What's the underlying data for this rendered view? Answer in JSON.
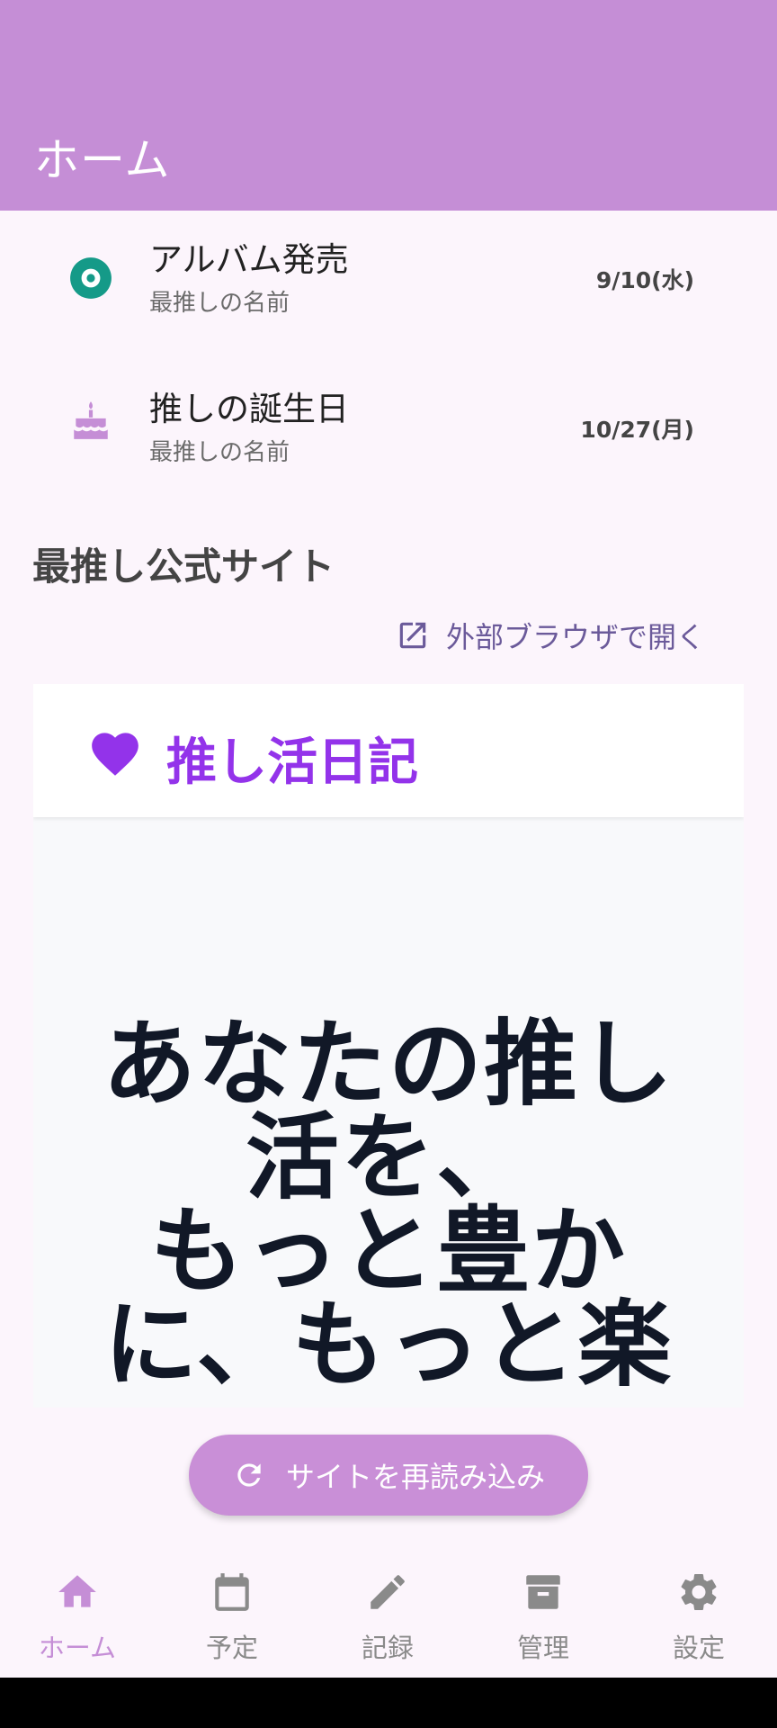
{
  "appbar": {
    "title": "ホーム"
  },
  "events": [
    {
      "icon": "disc-icon",
      "title": "アルバム発売",
      "subtitle": "最推しの名前",
      "date": "9/10(水)",
      "color": "#159a88"
    },
    {
      "icon": "cake-icon",
      "title": "推しの誕生日",
      "subtitle": "最推しの名前",
      "date": "10/27(月)",
      "color": "#c58ed6"
    }
  ],
  "official_site": {
    "section_title": "最推し公式サイト",
    "open_browser_label": "外部ブラウザで開く",
    "brand_name": "推し活日記",
    "brand_color": "#9333ea",
    "hero_text": "あなたの推し\n活を、\nもっと豊か\nに、もっと楽",
    "reload_label": "サイトを再読み込み"
  },
  "bottom_nav": [
    {
      "icon": "home-icon",
      "label": "ホーム",
      "active": true
    },
    {
      "icon": "calendar-icon",
      "label": "予定",
      "active": false
    },
    {
      "icon": "pencil-icon",
      "label": "記録",
      "active": false
    },
    {
      "icon": "archive-icon",
      "label": "管理",
      "active": false
    },
    {
      "icon": "gear-icon",
      "label": "設定",
      "active": false
    }
  ],
  "colors": {
    "primary": "#c58ed6",
    "background": "#fcf5fc",
    "accent_teal": "#159a88"
  }
}
